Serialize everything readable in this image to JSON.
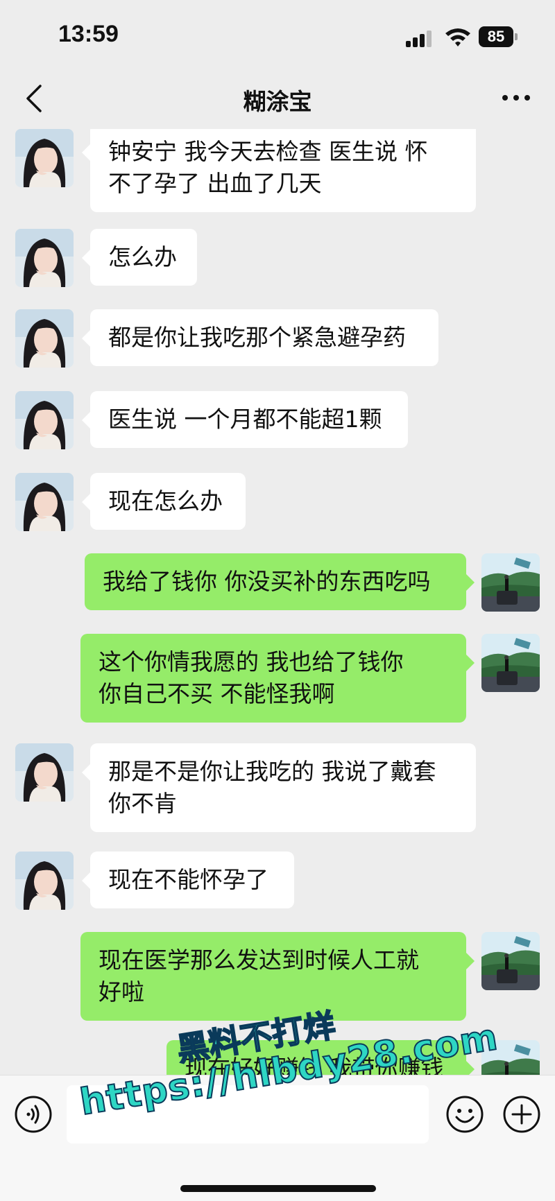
{
  "status_bar": {
    "time": "13:59",
    "battery": "85"
  },
  "nav": {
    "title": "糊涂宝"
  },
  "messages": [
    {
      "side": "in",
      "text": "钟安宁 我今天去检查 医生说 怀\n不了孕了 出血了几天"
    },
    {
      "side": "in",
      "text": "怎么办"
    },
    {
      "side": "in",
      "text": "都是你让我吃那个紧急避孕药"
    },
    {
      "side": "in",
      "text": "医生说 一个月都不能超1颗"
    },
    {
      "side": "in",
      "text": "现在怎么办"
    },
    {
      "side": "out",
      "text": "我给了钱你 你没买补的东西吃吗"
    },
    {
      "side": "out",
      "text": "这个你情我愿的 我也给了钱你\n你自己不买 不能怪我啊"
    },
    {
      "side": "in",
      "text": "那是不是你让我吃的 我说了戴套\n你不肯"
    },
    {
      "side": "in",
      "text": "现在不能怀孕了"
    },
    {
      "side": "out",
      "text": "现在医学那么发达到时候人工就\n好啦"
    },
    {
      "side": "out",
      "text": "现在好好赚钱 我带你赚钱"
    }
  ],
  "watermark": {
    "line1": "黑料不打烊",
    "line2": "https://hlbdy28.com"
  },
  "colors": {
    "incoming_bubble": "#ffffff",
    "outgoing_bubble": "#95ec69",
    "background": "#ededed"
  }
}
